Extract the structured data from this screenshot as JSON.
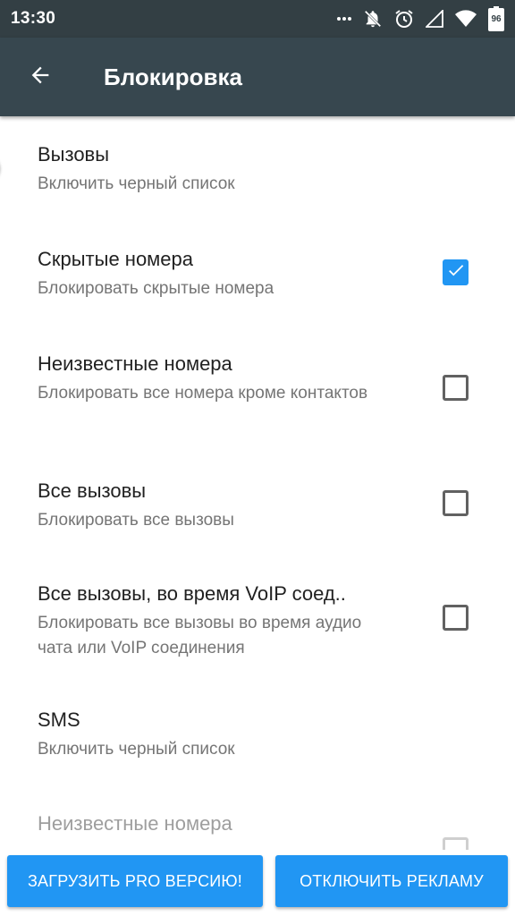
{
  "status_bar": {
    "time": "13:30",
    "battery_text": "96",
    "icons": [
      "more-icon",
      "bell-off-icon",
      "alarm-icon",
      "signal-icon",
      "wifi-icon",
      "battery-icon"
    ]
  },
  "app_bar": {
    "title": "Блокировка",
    "back_icon": "arrow-back-icon"
  },
  "settings": [
    {
      "title": "Вызовы",
      "subtitle": "Включить черный список",
      "control": "switch",
      "on": true
    },
    {
      "title": "Скрытые номера",
      "subtitle": "Блокировать скрытые номера",
      "control": "checkbox",
      "checked": true
    },
    {
      "title": "Неизвестные номера",
      "subtitle": "Блокировать все номера кроме контактов",
      "control": "checkbox",
      "checked": false
    },
    {
      "title": "Все вызовы",
      "subtitle": "Блокировать все вызовы",
      "control": "checkbox",
      "checked": false
    },
    {
      "title": "Все вызовы, во время VoIP соед..",
      "subtitle": "Блокировать все вызовы во время аудио чата или VoIP соединения",
      "control": "checkbox",
      "checked": false
    },
    {
      "title": "SMS",
      "subtitle": "Включить черный список",
      "control": "switch",
      "on": false
    },
    {
      "title": "Неизвестные номера",
      "subtitle": "",
      "control": "checkbox",
      "checked": false,
      "disabled": true
    }
  ],
  "buttons": {
    "pro_label": "ЗАГРУЗИТЬ PRO ВЕРСИЮ!",
    "ads_label": "ОТКЛЮЧИТЬ РЕКЛАМУ"
  },
  "colors": {
    "status_bar": "#333f44",
    "app_bar": "#37474f",
    "accent": "#2196f3"
  }
}
